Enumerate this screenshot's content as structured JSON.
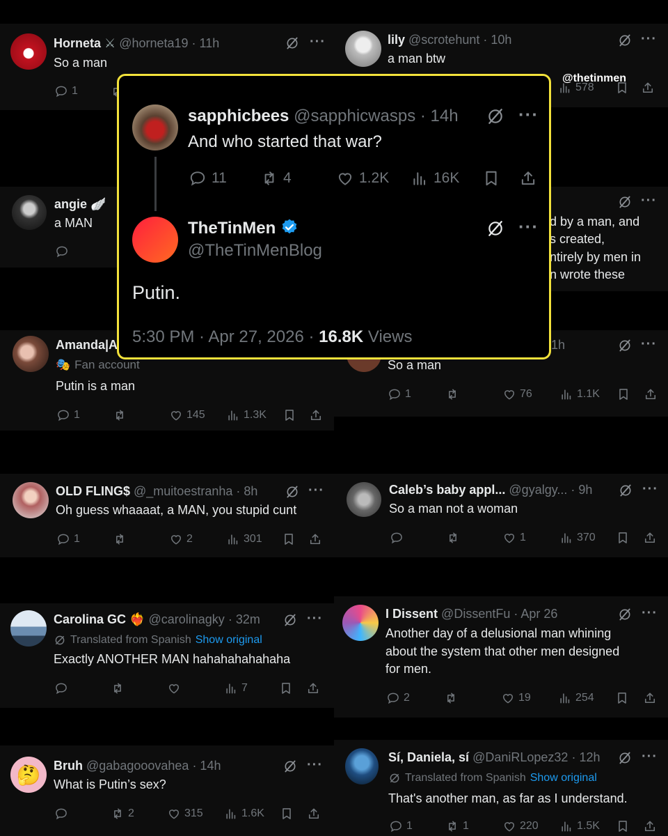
{
  "watermark": "@thetinmen",
  "background_tweets": {
    "horneta": {
      "name": "Horneta",
      "handle": "@horneta19",
      "time": "· 11h",
      "text": "So a man",
      "replies": "1"
    },
    "lily": {
      "name": "lily",
      "handle": "@scrotehunt",
      "time": "· 10h",
      "text": "a man btw",
      "views": "578"
    },
    "angie": {
      "name": "angie",
      "text": "a MAN"
    },
    "partial_right_top": {
      "line1": "d by a man, and",
      "line2": "s created,",
      "line3": "ntirely by men in",
      "line4": "n wrote these"
    },
    "amanda": {
      "name": "Amanda|A",
      "badge": "Fan account",
      "text": "Putin is a man",
      "replies": "1",
      "likes": "145",
      "views": "1.3K"
    },
    "partial_right_mid": {
      "time": "1h",
      "text": "So a man",
      "replies": "1",
      "likes": "76",
      "views": "1.1K"
    },
    "oldflings": {
      "name": "OLD FLING$",
      "handle": "@_muitoestranha",
      "time": "· 8h",
      "text": "Oh guess whaaaat, a MAN, you stupid cunt",
      "replies": "1",
      "likes": "2",
      "views": "301"
    },
    "caleb": {
      "name": "Caleb’s baby appl...",
      "handle": "@gyalgy...",
      "time": "· 9h",
      "text": "So a man not a woman",
      "likes": "1",
      "views": "370"
    },
    "carolina": {
      "name": "Carolina GC",
      "handle": "@carolinagky",
      "time": "· 32m",
      "translated": "Translated from Spanish",
      "show_original": "Show original",
      "text": "Exactly ANOTHER MAN hahahahahahaha",
      "views": "7"
    },
    "idissent": {
      "name": "I Dissent",
      "handle": "@DissentFu",
      "time": "· Apr 26",
      "line1": "Another day of a delusional man whining",
      "line2": "about the system that other men designed",
      "line3": "for men.",
      "replies": "2",
      "likes": "19",
      "views": "254"
    },
    "bruh": {
      "name": "Bruh",
      "handle": "@gabagooovahea",
      "time": "· 14h",
      "text": "What is Putin’s sex?",
      "retweets": "2",
      "likes": "315",
      "views": "1.6K"
    },
    "daniela": {
      "name": "Sí, Daniela, sí",
      "handle": "@DaniRLopez32",
      "time": "· 12h",
      "translated": "Translated from Spanish",
      "show_original": "Show original",
      "text": "That's another man, as far as I understand.",
      "replies": "1",
      "retweets": "1",
      "likes": "220",
      "views": "1.5K"
    }
  },
  "popup": {
    "reply": {
      "name": "sapphicbees",
      "handle": "@sapphicwasps",
      "time": "· 14h",
      "text": "And who started that war?",
      "replies": "11",
      "retweets": "4",
      "likes": "1.2K",
      "views": "16K"
    },
    "main": {
      "name": "TheTinMen",
      "handle": "@TheTinMenBlog",
      "text": "Putin.",
      "timestamp": "5:30 PM · Apr 27, 2026 ·",
      "views_count": "16.8K",
      "views_label": "Views"
    }
  },
  "colors": {
    "accent_yellow": "#f3e23b",
    "verified_blue": "#1d9bf0",
    "link": "#1d9bf0"
  }
}
